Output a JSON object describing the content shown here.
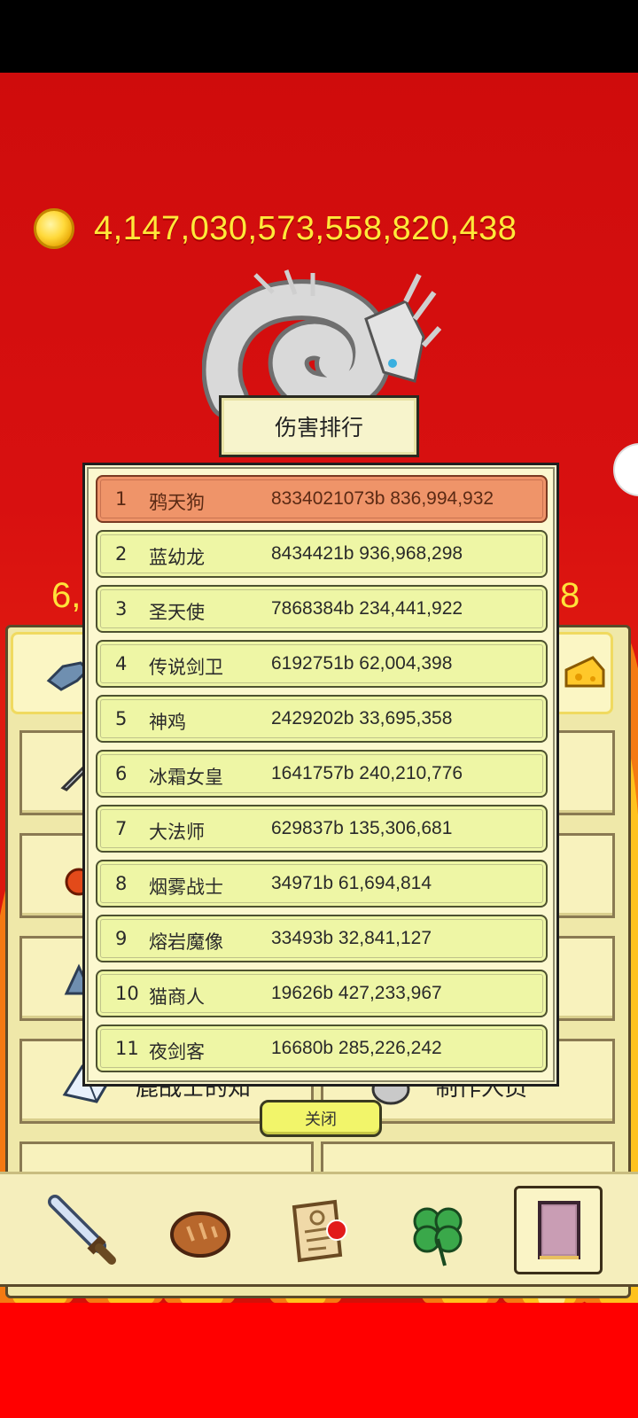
{
  "currency": {
    "icon": "gold-coin-icon",
    "amount": "4,147,030,573,558,820,438"
  },
  "side_numbers": {
    "left": "6,",
    "right": "8"
  },
  "ranking": {
    "title": "伤害排行",
    "rows": [
      {
        "rank": "1",
        "name": "鸦天狗",
        "score": "8334021073b 836,994,932"
      },
      {
        "rank": "2",
        "name": "蓝幼龙",
        "score": "8434421b 936,968,298"
      },
      {
        "rank": "3",
        "name": "圣天使",
        "score": "7868384b 234,441,922"
      },
      {
        "rank": "4",
        "name": "传说剑卫",
        "score": "6192751b 62,004,398"
      },
      {
        "rank": "5",
        "name": "神鸡",
        "score": "2429202b 33,695,358"
      },
      {
        "rank": "6",
        "name": "冰霜女皇",
        "score": "1641757b 240,210,776"
      },
      {
        "rank": "7",
        "name": "大法师",
        "score": "629837b 135,306,681"
      },
      {
        "rank": "8",
        "name": "烟雾战士",
        "score": "34971b 61,694,814"
      },
      {
        "rank": "9",
        "name": "熔岩魔像",
        "score": "33493b 32,841,127"
      },
      {
        "rank": "10",
        "name": "猫商人",
        "score": "19626b 427,233,967"
      },
      {
        "rank": "11",
        "name": "夜剑客",
        "score": "16680b 285,226,242"
      }
    ],
    "close_label": "关闭"
  },
  "menu": {
    "knowledge_label": "鹿战士的知",
    "credits_label": "制作人员"
  },
  "bottom_nav": {
    "items": [
      "sword-icon",
      "bread-icon",
      "scroll-icon",
      "clover-icon",
      "book-icon"
    ],
    "active": "book-icon"
  },
  "colors": {
    "accent_gold": "#ffe93a",
    "highlight_row": "#ef9469",
    "row_bg": "#eef6a5"
  }
}
